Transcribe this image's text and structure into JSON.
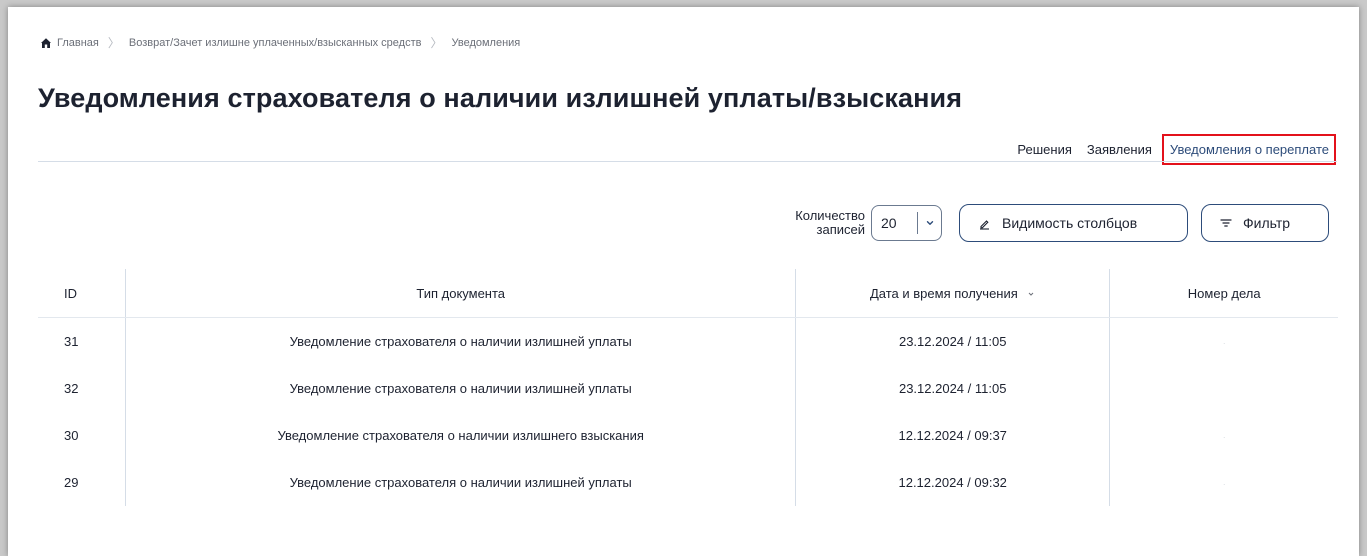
{
  "breadcrumb": {
    "home": "Главная",
    "section": "Возврат/Зачет излишне уплаченных/взысканных средств",
    "current": "Уведомления"
  },
  "page_title": "Уведомления страхователя о наличии излишней уплаты/взыскания",
  "tabs": [
    {
      "label": "Решения",
      "active": false
    },
    {
      "label": "Заявления",
      "active": false
    },
    {
      "label": "Уведомления о переплате",
      "active": true
    }
  ],
  "toolbar": {
    "records_label_line1": "Количество",
    "records_label_line2": "записей",
    "records_value": "20",
    "columns_button": "Видимость столбцов",
    "filter_button": "Фильтр"
  },
  "table": {
    "headers": {
      "id": "ID",
      "type": "Тип документа",
      "date": "Дата и время получения",
      "case": "Номер дела"
    },
    "rows": [
      {
        "id": "31",
        "type": "Уведомление страхователя о наличии излишней уплаты",
        "date": "23.12.2024 / 11:05",
        "case": "·"
      },
      {
        "id": "32",
        "type": "Уведомление страхователя о наличии излишней уплаты",
        "date": "23.12.2024 / 11:05",
        "case": ""
      },
      {
        "id": "30",
        "type": "Уведомление страхователя о наличии излишнего взыскания",
        "date": "12.12.2024 / 09:37",
        "case": "·"
      },
      {
        "id": "29",
        "type": "Уведомление страхователя о наличии излишней уплаты",
        "date": "12.12.2024 / 09:32",
        "case": "·"
      }
    ]
  },
  "colors": {
    "accent": "#2d4c7a",
    "highlight": "#e3111b",
    "text": "#1d2230"
  }
}
